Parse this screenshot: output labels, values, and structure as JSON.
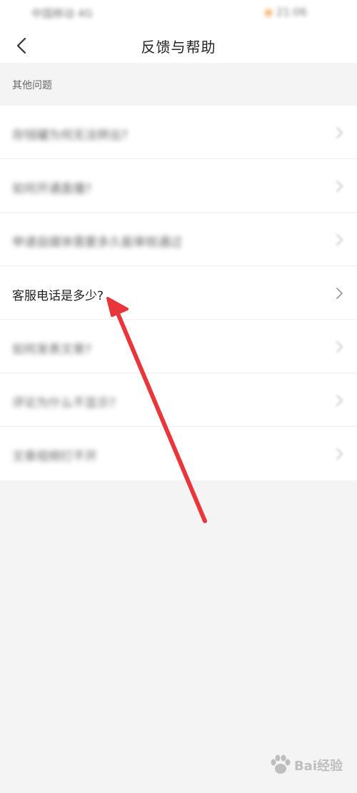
{
  "status_bar": {
    "carrier": "中国移动 4G",
    "time": "21:06"
  },
  "nav": {
    "title": "反馈与帮助",
    "back_icon": "chevron-left-icon"
  },
  "section": {
    "title": "其他问题"
  },
  "items": [
    {
      "label": "存钱罐为何无法转出?",
      "blurred": true
    },
    {
      "label": "如何开通直播?",
      "blurred": true
    },
    {
      "label": "申请自媒体需要多久能审核通过",
      "blurred": true
    },
    {
      "label": "客服电话是多少?",
      "blurred": false
    },
    {
      "label": "如何发表文章?",
      "blurred": true
    },
    {
      "label": "评论为什么不显示?",
      "blurred": true
    },
    {
      "label": "文章视频打不开",
      "blurred": true
    }
  ],
  "annotation": {
    "color": "#e8363a"
  },
  "watermark": {
    "text": "Bai经验"
  }
}
